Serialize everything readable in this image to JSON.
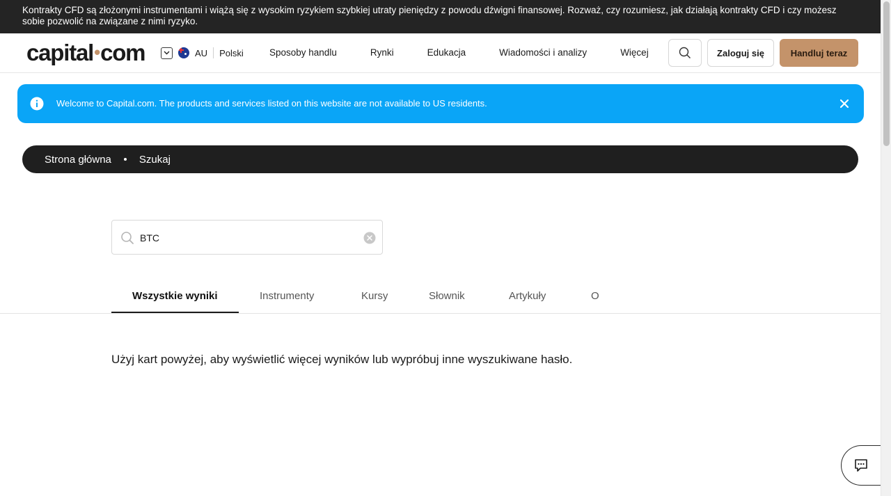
{
  "risk_warning": "Kontrakty CFD są złożonymi instrumentami i wiążą się z wysokim ryzykiem szybkiej utraty pieniędzy z powodu dźwigni finansowej. Rozważ, czy rozumiesz, jak działają kontrakty CFD i czy możesz sobie pozwolić na związane z nimi ryzyko.",
  "header": {
    "logo_left": "capital",
    "logo_dot": "•",
    "logo_right": "com",
    "region": "AU",
    "language": "Polski",
    "nav": [
      "Sposoby handlu",
      "Rynki",
      "Edukacja",
      "Wiadomości i analizy",
      "Więcej"
    ],
    "login_label": "Zaloguj się",
    "trade_label": "Handluj teraz"
  },
  "info_banner": {
    "message": "Welcome to Capital.com. The products and services listed on this website are not available to US residents."
  },
  "breadcrumb": {
    "home": "Strona główna",
    "current": "Szukaj"
  },
  "search": {
    "value": "BTC"
  },
  "tabs": [
    "Wszystkie wyniki",
    "Instrumenty",
    "Kursy",
    "Słownik",
    "Artykuły",
    "O"
  ],
  "hint_text": "Użyj kart powyżej, aby wyświetlić więcej wyników lub wypróbuj inne wyszukiwane hasło.",
  "colors": {
    "accent": "#c4936a",
    "info_blue": "#0aa5f7",
    "dark": "#242424"
  }
}
